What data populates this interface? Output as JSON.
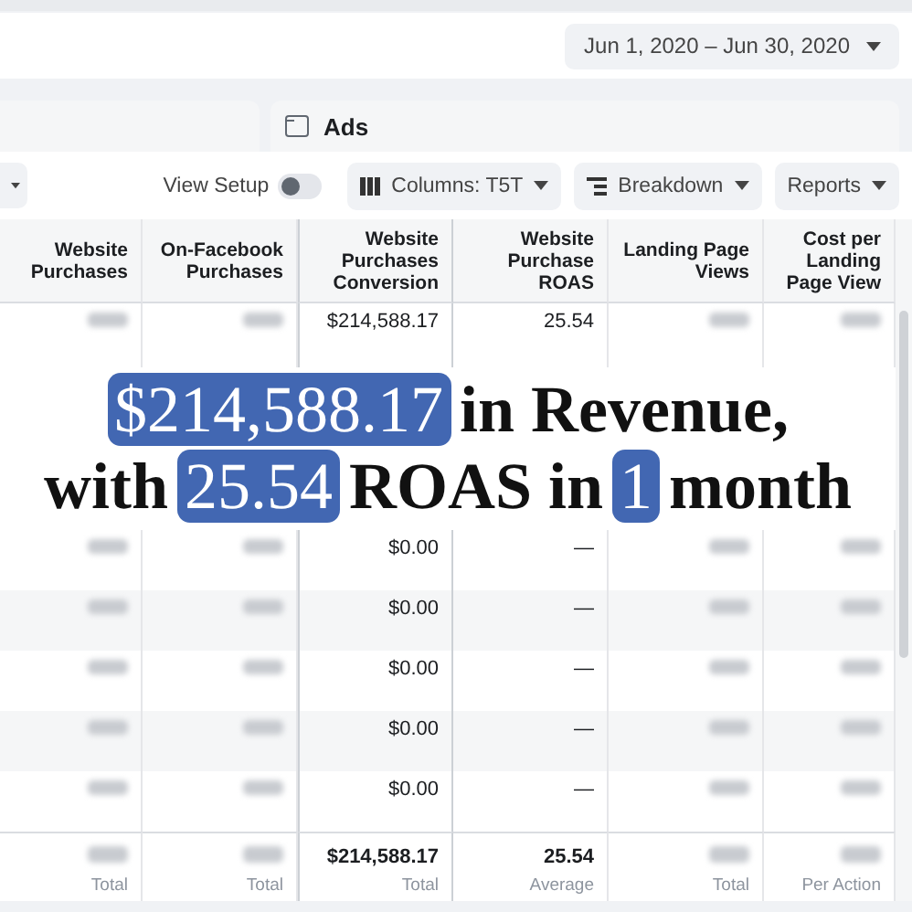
{
  "date_range": {
    "label": "Jun 1, 2020 – Jun 30, 2020"
  },
  "level_tab": {
    "label": "Ads"
  },
  "toolbar": {
    "view_setup": {
      "label": "View Setup",
      "on": false
    },
    "buttons": [
      {
        "label": "Columns: T5T",
        "kind": "columns"
      },
      {
        "label": "Breakdown",
        "kind": "breakdown"
      },
      {
        "label": "Reports",
        "kind": "plain"
      }
    ]
  },
  "table": {
    "columns": [
      "Website Purchases",
      "On-Facebook Purchases",
      "Website Purchases Conversion",
      "Website Purchase ROAS",
      "Landing Page Views",
      "Cost per Landing Page View"
    ],
    "top_rows": [
      [
        {
          "kind": "blurred"
        },
        {
          "kind": "blurred"
        },
        {
          "kind": "value",
          "text": "$214,588.17"
        },
        {
          "kind": "value",
          "text": "25.54"
        },
        {
          "kind": "blurred"
        },
        {
          "kind": "blurred"
        }
      ]
    ],
    "rows": [
      [
        {
          "kind": "blurred"
        },
        {
          "kind": "blurred"
        },
        {
          "kind": "value",
          "text": "$0.00"
        },
        {
          "kind": "value",
          "text": "—"
        },
        {
          "kind": "blurred"
        },
        {
          "kind": "blurred"
        }
      ],
      [
        {
          "kind": "blurred"
        },
        {
          "kind": "blurred"
        },
        {
          "kind": "value",
          "text": "$0.00"
        },
        {
          "kind": "value",
          "text": "—"
        },
        {
          "kind": "blurred"
        },
        {
          "kind": "blurred"
        }
      ],
      [
        {
          "kind": "blurred"
        },
        {
          "kind": "blurred"
        },
        {
          "kind": "value",
          "text": "$0.00"
        },
        {
          "kind": "value",
          "text": "—"
        },
        {
          "kind": "blurred"
        },
        {
          "kind": "blurred"
        }
      ],
      [
        {
          "kind": "blurred"
        },
        {
          "kind": "blurred"
        },
        {
          "kind": "value",
          "text": "$0.00"
        },
        {
          "kind": "value",
          "text": "—"
        },
        {
          "kind": "blurred"
        },
        {
          "kind": "blurred"
        }
      ],
      [
        {
          "kind": "blurred"
        },
        {
          "kind": "blurred"
        },
        {
          "kind": "value",
          "text": "$0.00"
        },
        {
          "kind": "value",
          "text": "—"
        },
        {
          "kind": "blurred"
        },
        {
          "kind": "blurred"
        }
      ]
    ],
    "totals": [
      {
        "kind": "blurred",
        "note": "Total"
      },
      {
        "kind": "blurred",
        "note": "Total"
      },
      {
        "kind": "value",
        "text": "$214,588.17",
        "note": "Total"
      },
      {
        "kind": "value",
        "text": "25.54",
        "note": "Average"
      },
      {
        "kind": "blurred",
        "note": "Total"
      },
      {
        "kind": "blurred",
        "note": "Per Action"
      }
    ]
  },
  "banner": {
    "lines": [
      [
        {
          "text": "$214,588.17",
          "highlight": true
        },
        {
          "text": "in Revenue,",
          "highlight": false
        }
      ],
      [
        {
          "text": "with",
          "highlight": false
        },
        {
          "text": "25.54",
          "highlight": true
        },
        {
          "text": "ROAS in",
          "highlight": false
        },
        {
          "text": "1",
          "highlight": true
        },
        {
          "text": "month",
          "highlight": false
        }
      ]
    ]
  }
}
